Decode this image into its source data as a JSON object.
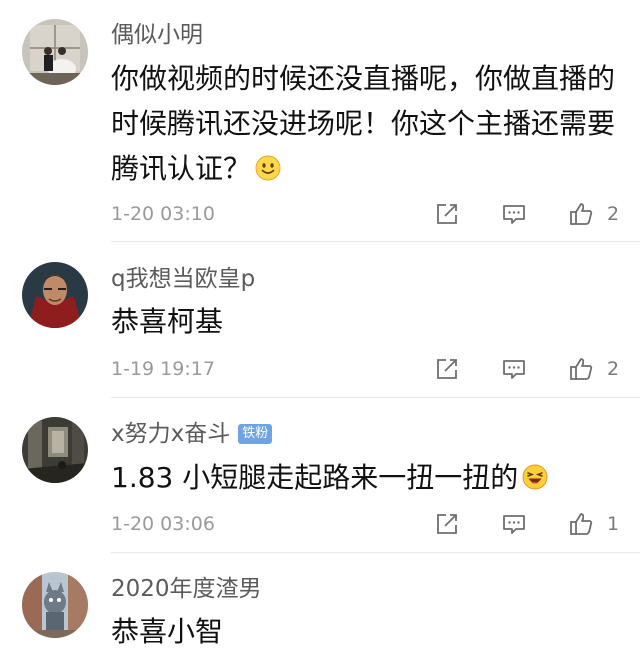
{
  "comments": [
    {
      "username": "偶似小明",
      "text": "你做视频的时候还没直播呢，你做直播的时候腾讯还没进场呢！你这个主播还需要腾讯认证？",
      "emoji": "smile-emoji",
      "time": "1-20 03:10",
      "likes": "2",
      "badge": ""
    },
    {
      "username": "q我想当欧皇p",
      "text": "恭喜柯基",
      "emoji": "",
      "time": "1-19 19:17",
      "likes": "2",
      "badge": ""
    },
    {
      "username": "x努力x奋斗",
      "badge": "铁粉",
      "text": "1.83 小短腿走起路来一扭一扭的",
      "emoji": "laugh-emoji",
      "time": "1-20 03:06",
      "likes": "1"
    },
    {
      "username": "2020年度渣男",
      "text": "恭喜小智",
      "emoji": "",
      "time": "",
      "likes": "",
      "badge": ""
    }
  ],
  "icons": {
    "share": "share-icon",
    "comment": "comment-icon",
    "like": "thumbs-up-icon"
  },
  "colors": {
    "username": "#5b5b5b",
    "text": "#111111",
    "meta": "#9a9a9a",
    "badge": "#6fa3e6"
  }
}
